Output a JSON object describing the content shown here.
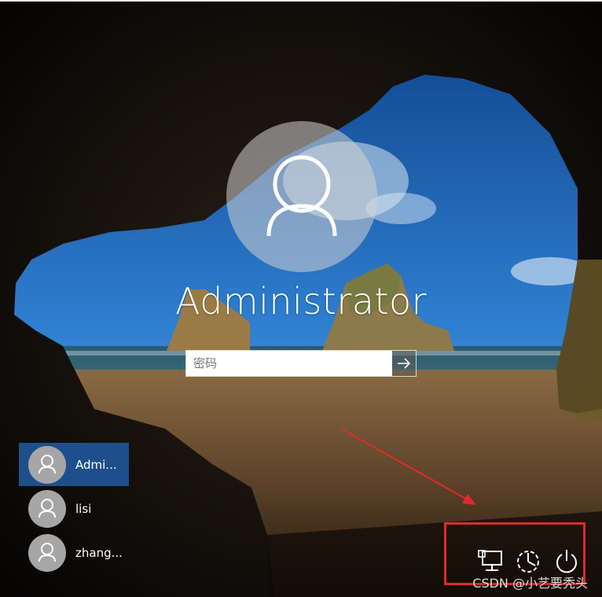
{
  "account": {
    "name": "Administrator",
    "password_placeholder": "密码"
  },
  "users": [
    {
      "label": "Admi...",
      "selected": true
    },
    {
      "label": "lisi",
      "selected": false
    },
    {
      "label": "zhang...",
      "selected": false
    }
  ],
  "system_icons": [
    "network-icon",
    "accessibility-icon",
    "power-icon"
  ],
  "annotation": {
    "highlight_color": "#e02a2a"
  },
  "watermark": "CSDN @小艺要秃头",
  "colors": {
    "selected_user": "#1f4f8a"
  }
}
